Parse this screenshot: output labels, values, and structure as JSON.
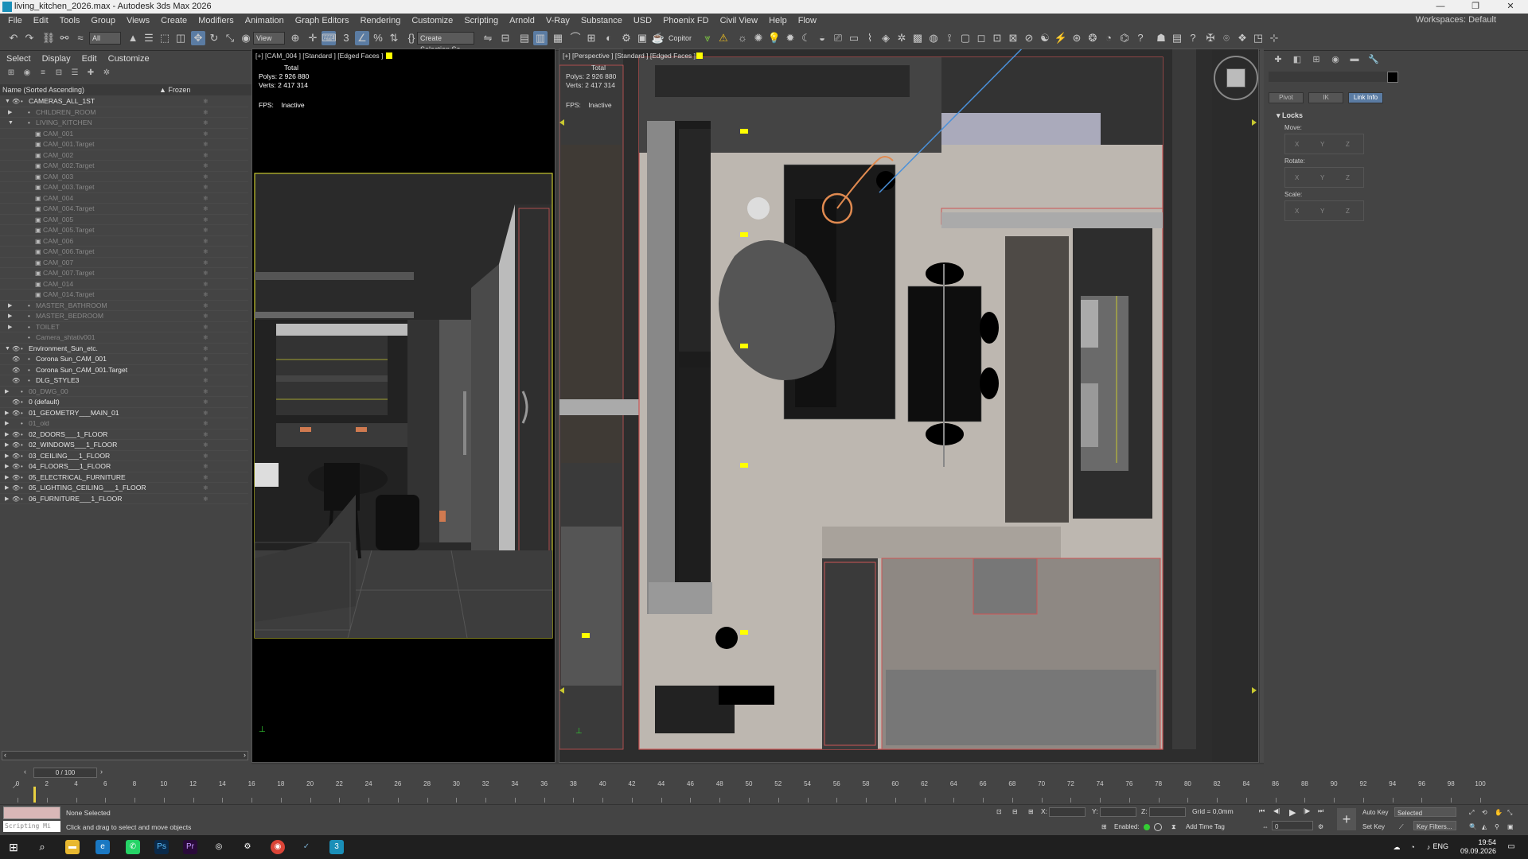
{
  "window": {
    "title": "living_kitchen_2026.max - Autodesk 3ds Max 2026"
  },
  "menu": [
    "File",
    "Edit",
    "Tools",
    "Group",
    "Views",
    "Create",
    "Modifiers",
    "Animation",
    "Graph Editors",
    "Rendering",
    "Customize",
    "Scripting",
    "Arnold",
    "V-Ray",
    "Substance",
    "USD",
    "Phoenix FD",
    "Civil View",
    "Help",
    "Flow"
  ],
  "workspaces": {
    "label": "Workspaces:",
    "value": "Default"
  },
  "toolbar": {
    "filter": "All",
    "refcoord": "View",
    "selset": "Create Selection Se",
    "copitor": "Copitor"
  },
  "scene_explorer": {
    "tabs": [
      "Select",
      "Display",
      "Edit",
      "Customize"
    ],
    "col_name": "Name (Sorted Ascending)",
    "col_frozen": "Frozen",
    "rows": [
      {
        "name": "CAMERAS_ALL_1ST",
        "level": 0,
        "toggle": "open",
        "vis": true,
        "dim": false
      },
      {
        "name": "CHILDREN_ROOM",
        "level": 1,
        "toggle": "closed",
        "vis": false,
        "dim": true
      },
      {
        "name": "LIVING_KITCHEN",
        "level": 1,
        "toggle": "open",
        "vis": false,
        "dim": true
      },
      {
        "name": "CAM_001",
        "level": 2,
        "toggle": "",
        "vis": false,
        "dim": true
      },
      {
        "name": "CAM_001.Target",
        "level": 2,
        "toggle": "",
        "vis": false,
        "dim": true
      },
      {
        "name": "CAM_002",
        "level": 2,
        "toggle": "",
        "vis": false,
        "dim": true
      },
      {
        "name": "CAM_002.Target",
        "level": 2,
        "toggle": "",
        "vis": false,
        "dim": true
      },
      {
        "name": "CAM_003",
        "level": 2,
        "toggle": "",
        "vis": false,
        "dim": true
      },
      {
        "name": "CAM_003.Target",
        "level": 2,
        "toggle": "",
        "vis": false,
        "dim": true
      },
      {
        "name": "CAM_004",
        "level": 2,
        "toggle": "",
        "vis": false,
        "dim": true
      },
      {
        "name": "CAM_004.Target",
        "level": 2,
        "toggle": "",
        "vis": false,
        "dim": true
      },
      {
        "name": "CAM_005",
        "level": 2,
        "toggle": "",
        "vis": false,
        "dim": true
      },
      {
        "name": "CAM_005.Target",
        "level": 2,
        "toggle": "",
        "vis": false,
        "dim": true
      },
      {
        "name": "CAM_006",
        "level": 2,
        "toggle": "",
        "vis": false,
        "dim": true
      },
      {
        "name": "CAM_006.Target",
        "level": 2,
        "toggle": "",
        "vis": false,
        "dim": true
      },
      {
        "name": "CAM_007",
        "level": 2,
        "toggle": "",
        "vis": false,
        "dim": true
      },
      {
        "name": "CAM_007.Target",
        "level": 2,
        "toggle": "",
        "vis": false,
        "dim": true
      },
      {
        "name": "CAM_014",
        "level": 2,
        "toggle": "",
        "vis": false,
        "dim": true
      },
      {
        "name": "CAM_014.Target",
        "level": 2,
        "toggle": "",
        "vis": false,
        "dim": true
      },
      {
        "name": "MASTER_BATHROOM",
        "level": 1,
        "toggle": "closed",
        "vis": false,
        "dim": true
      },
      {
        "name": "MASTER_BEDROOM",
        "level": 1,
        "toggle": "closed",
        "vis": false,
        "dim": true
      },
      {
        "name": "TOILET",
        "level": 1,
        "toggle": "closed",
        "vis": false,
        "dim": true
      },
      {
        "name": "Camera_shtativ001",
        "level": 1,
        "toggle": "",
        "vis": false,
        "dim": true
      },
      {
        "name": "Environment_Sun_etc.",
        "level": 0,
        "toggle": "open",
        "vis": true,
        "dim": false
      },
      {
        "name": "Corona Sun_CAM_001",
        "level": 1,
        "toggle": "",
        "vis": true,
        "dim": false
      },
      {
        "name": "Corona Sun_CAM_001.Target",
        "level": 1,
        "toggle": "",
        "vis": true,
        "dim": false
      },
      {
        "name": "DLG_STYLE3",
        "level": 1,
        "toggle": "",
        "vis": true,
        "dim": false
      },
      {
        "name": "00_DWG_00",
        "level": 0,
        "toggle": "closed",
        "vis": false,
        "dim": true
      },
      {
        "name": "0 (default)",
        "level": 0,
        "toggle": "",
        "vis": true,
        "dim": false
      },
      {
        "name": "01_GEOMETRY___MAIN_01",
        "level": 0,
        "toggle": "closed",
        "vis": true,
        "dim": false
      },
      {
        "name": "01_old",
        "level": 0,
        "toggle": "closed",
        "vis": false,
        "dim": true
      },
      {
        "name": "02_DOORS___1_FLOOR",
        "level": 0,
        "toggle": "closed",
        "vis": true,
        "dim": false
      },
      {
        "name": "02_WINDOWS___1_FLOOR",
        "level": 0,
        "toggle": "closed",
        "vis": true,
        "dim": false
      },
      {
        "name": "03_CEILING___1_FLOOR",
        "level": 0,
        "toggle": "closed",
        "vis": true,
        "dim": false
      },
      {
        "name": "04_FLOORS___1_FLOOR",
        "level": 0,
        "toggle": "closed",
        "vis": true,
        "dim": false
      },
      {
        "name": "05_ELECTRICAL_FURNITURE",
        "level": 0,
        "toggle": "closed",
        "vis": true,
        "dim": false
      },
      {
        "name": "05_LIGHTING_CEILING___1_FLOOR",
        "level": 0,
        "toggle": "closed",
        "vis": true,
        "dim": false
      },
      {
        "name": "06_FURNITURE___1_FLOOR",
        "level": 0,
        "toggle": "closed",
        "vis": true,
        "dim": false
      }
    ]
  },
  "viewport_left": {
    "header": "[+] [CAM_004 ] [Standard ] [Edged Faces ]",
    "stats_total": "Total",
    "polys_label": "Polys:",
    "polys": "2 926 880",
    "verts_label": "Verts:",
    "verts": "2 417 314",
    "fps_label": "FPS:",
    "fps": "Inactive"
  },
  "viewport_right": {
    "header": "[+] [Perspective ] [Standard ] [Edged Faces ]",
    "stats_total": "Total",
    "polys_label": "Polys:",
    "polys": "2 926 880",
    "verts_label": "Verts:",
    "verts": "2 417 314",
    "fps_label": "FPS:",
    "fps": "Inactive"
  },
  "command_panel": {
    "buttons": [
      "Pivot",
      "IK",
      "Link Info"
    ],
    "locks_title": "Locks",
    "move": "Move:",
    "rotate": "Rotate:",
    "scale": "Scale:",
    "axes": [
      "X",
      "Y",
      "Z"
    ]
  },
  "timeline": {
    "frame": "0 / 100",
    "ticks": [
      0,
      2,
      4,
      6,
      8,
      10,
      12,
      14,
      16,
      18,
      20,
      22,
      24,
      26,
      28,
      30,
      32,
      34,
      36,
      38,
      40,
      42,
      44,
      46,
      48,
      50,
      52,
      54,
      56,
      58,
      60,
      62,
      64,
      66,
      68,
      70,
      72,
      74,
      76,
      78,
      80,
      82,
      84,
      86,
      88,
      90,
      92,
      94,
      96,
      98,
      100
    ]
  },
  "status": {
    "selection": "None Selected",
    "prompt": "Click and drag to select and move objects",
    "scripting": "Scripting Mi",
    "x": "X:",
    "y": "Y:",
    "z": "Z:",
    "grid": "Grid = 0,0mm",
    "enabled": "Enabled:",
    "add_time_tag": "Add Time Tag",
    "auto_key": "Auto Key",
    "selected": "Selected",
    "set_key": "Set Key",
    "key_filters": "Key Filters...",
    "frame_val": "0"
  },
  "taskbar": {
    "lang": "ENG",
    "time": "19:54",
    "date": "09.09.2026"
  },
  "colors": {
    "accent": "#5b7ca3",
    "sel_yellow": "#ffff00",
    "red_line": "#e05050"
  }
}
